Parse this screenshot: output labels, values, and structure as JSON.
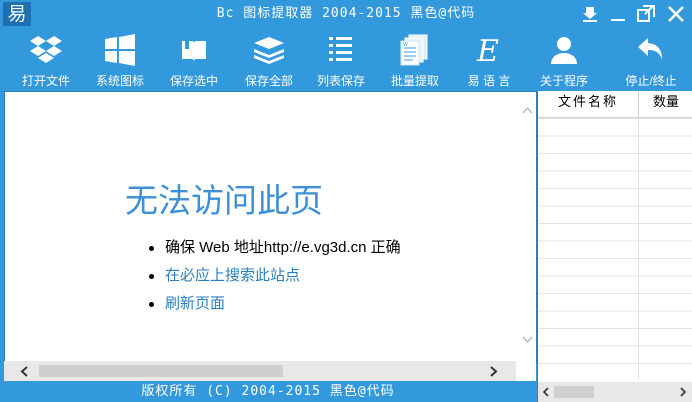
{
  "window": {
    "app_icon_glyph": "易",
    "title": "Bc  图标提取器  2004-2015 黑色@代码",
    "controls": [
      "download-icon",
      "minimize-icon",
      "restore-icon",
      "close-icon"
    ]
  },
  "toolbar": {
    "items": [
      {
        "label": "打开文件",
        "icon": "dropbox-icon"
      },
      {
        "label": "系统图标",
        "icon": "windows-icon"
      },
      {
        "label": "保存选中",
        "icon": "book-icon"
      },
      {
        "label": "保存全部",
        "icon": "stack-icon"
      },
      {
        "label": "列表保存",
        "icon": "list-icon"
      },
      {
        "label": "批量提取",
        "icon": "documents-icon"
      },
      {
        "label": "易 语 言",
        "icon": "e-language-icon"
      },
      {
        "label": "关于程序",
        "icon": "user-icon"
      },
      {
        "label": "停止/终止",
        "icon": "back-arrow-icon"
      }
    ]
  },
  "browser": {
    "error_title": "无法访问此页",
    "bullets": [
      {
        "text": "确保 Web 地址http://e.vg3d.cn 正确",
        "link": false
      },
      {
        "text": "在必应上搜索此站点",
        "link": true
      },
      {
        "text": "刷新页面",
        "link": true
      }
    ]
  },
  "list_panel": {
    "columns": [
      "文件名称",
      "数量"
    ]
  },
  "status": {
    "text": "版权所有 (C) 2004-2015 黑色@代码"
  },
  "colors": {
    "frame": "#3399dd",
    "link": "#2a7fc0",
    "error_title": "#3d8fd6"
  }
}
